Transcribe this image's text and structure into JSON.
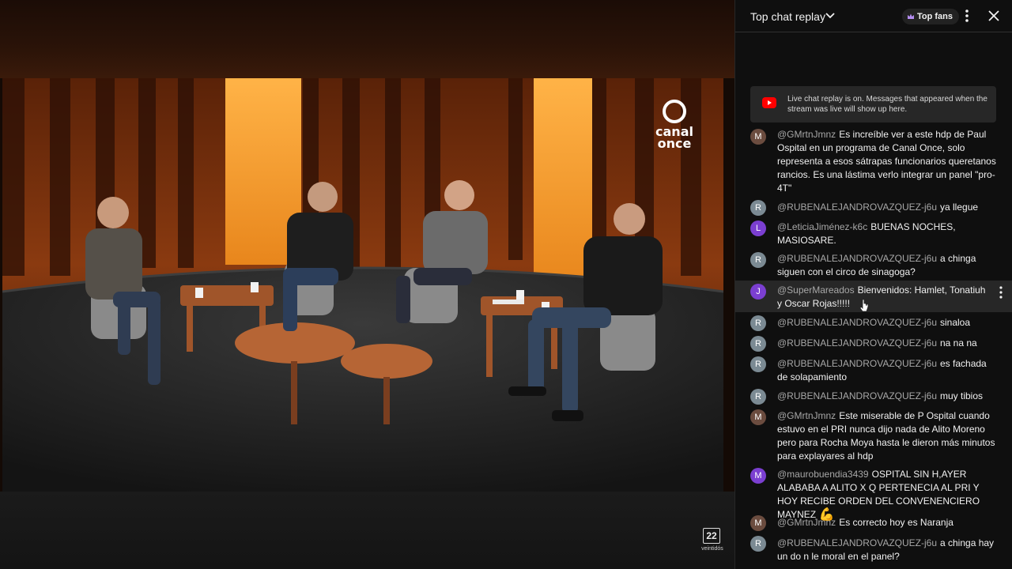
{
  "video": {
    "channel_logo_line1": "canal",
    "channel_logo_line2": "once",
    "watermark_number": "22",
    "watermark_caption": "veintidós"
  },
  "chat": {
    "title": "Top chat replay",
    "top_fans_label": "Top fans",
    "banner_text": "Live chat replay is on. Messages that appeared when the stream was live will show up here.",
    "colors": {
      "avatar_brown": "#6b4c3f",
      "avatar_gray": "#7b8a93",
      "avatar_purple": "#7b3fd1",
      "highlight_bg": "#272727"
    },
    "messages": [
      {
        "initial": "M",
        "author": "@GMrtnJmnz",
        "text": "Es increíble ver a este hdp de Paul Ospital en un programa de Canal Once, solo representa a esos sátrapas funcionarios queretanos rancios. Es una lástima verlo integrar un panel \"pro-4T\""
      },
      {
        "initial": "R",
        "author": "@RUBENALEJANDROVAZQUEZ-j6u",
        "text": "ya llegue"
      },
      {
        "initial": "L",
        "author": "@LeticiaJiménez-k6c",
        "text": "BUENAS NOCHES, MASIOSARE."
      },
      {
        "initial": "R",
        "author": "@RUBENALEJANDROVAZQUEZ-j6u",
        "text": "a chinga siguen con el circo de sinagoga?"
      },
      {
        "initial": "J",
        "author": "@SuperMareados",
        "text": "Bienvenidos: Hamlet, Tonatiuh y Oscar Rojas!!!!!"
      },
      {
        "initial": "R",
        "author": "@RUBENALEJANDROVAZQUEZ-j6u",
        "text": "sinaloa"
      },
      {
        "initial": "R",
        "author": "@RUBENALEJANDROVAZQUEZ-j6u",
        "text": "na na na"
      },
      {
        "initial": "R",
        "author": "@RUBENALEJANDROVAZQUEZ-j6u",
        "text": "es fachada de solapamiento"
      },
      {
        "initial": "R",
        "author": "@RUBENALEJANDROVAZQUEZ-j6u",
        "text": "muy tibios"
      },
      {
        "initial": "M",
        "author": "@GMrtnJmnz",
        "text": "Este miserable de P Ospital cuando estuvo en el PRI nunca dijo nada de Alito Moreno pero para Rocha Moya hasta le dieron más minutos para explayares al hdp"
      },
      {
        "initial": "M",
        "author": "@maurobuendia3439",
        "text": "OSPITAL SIN H,AYER ALABABA A ALITO X Q PERTENECIA AL PRI Y HOY RECIBE ORDEN DEL CONVENENCIERO MAYNEZ",
        "emoji": "💪"
      },
      {
        "initial": "M",
        "author": "@GMrtnJmnz",
        "text": "Es correcto hoy es Naranja"
      },
      {
        "initial": "R",
        "author": "@RUBENALEJANDROVAZQUEZ-j6u",
        "text": "a chinga hay un do n le moral en el panel?"
      }
    ]
  }
}
